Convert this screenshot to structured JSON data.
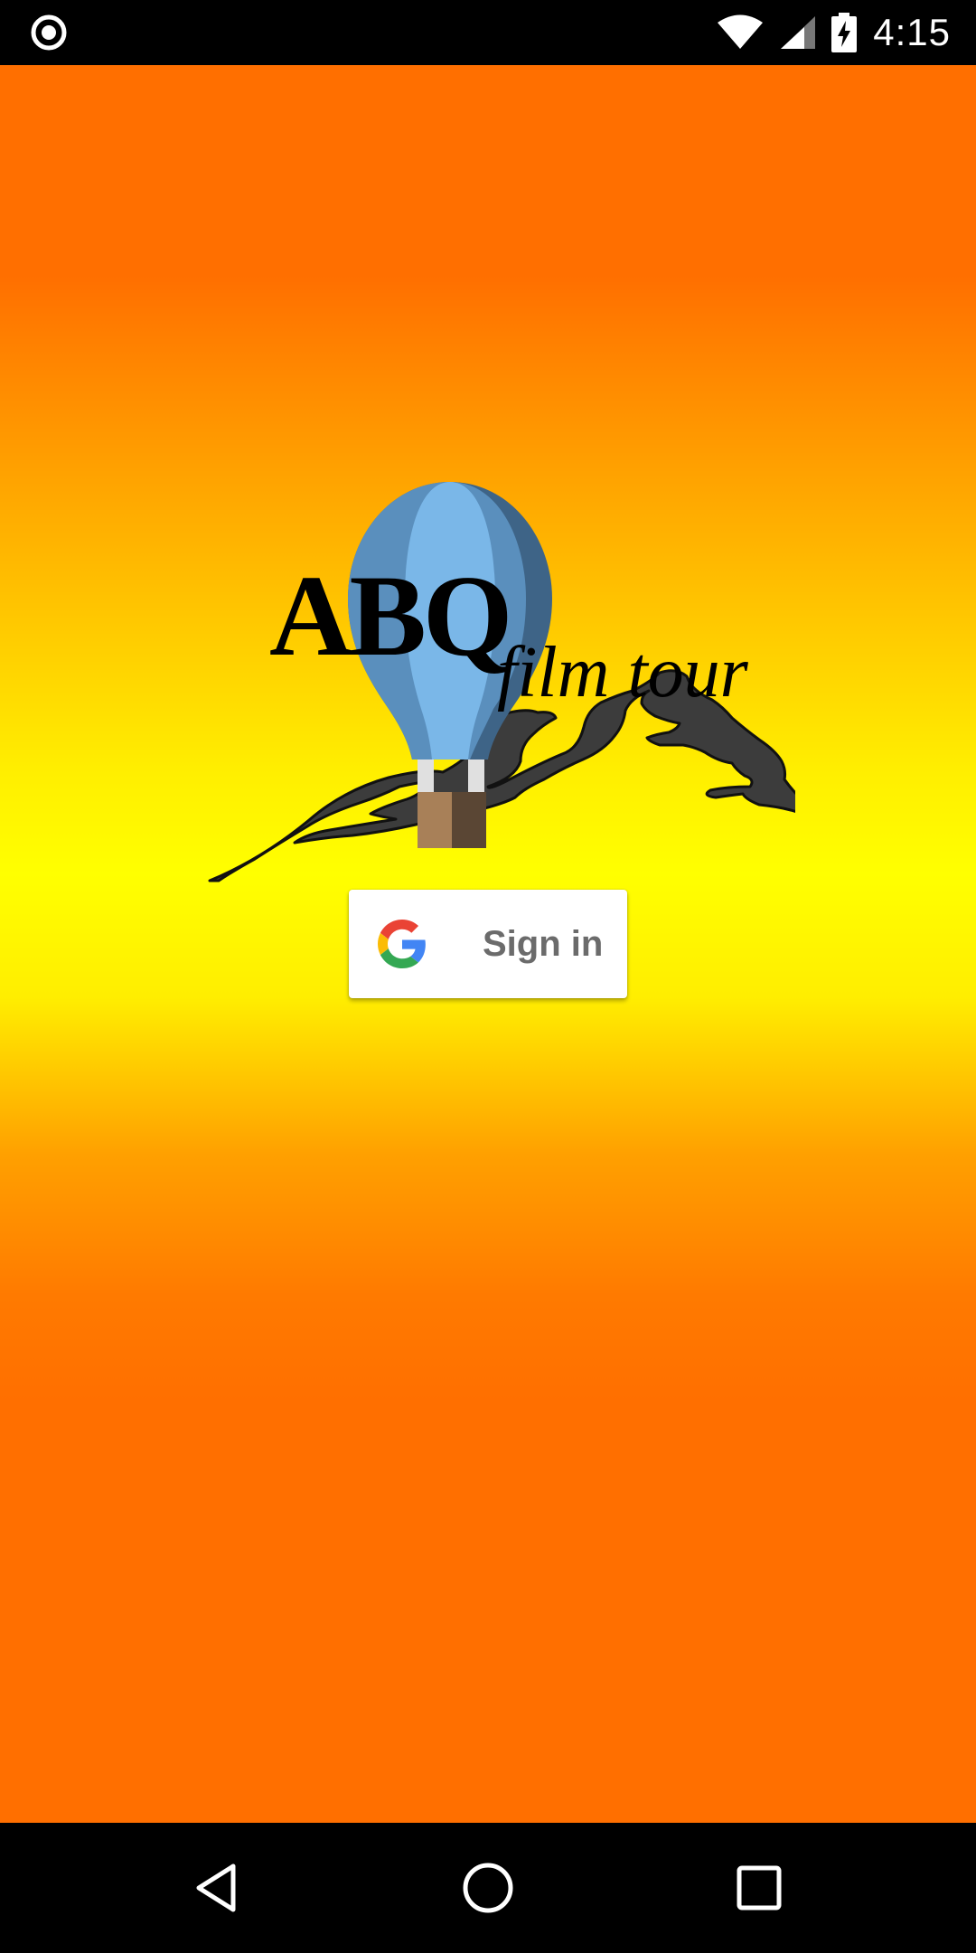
{
  "status_bar": {
    "time": "4:15",
    "icons": [
      "record-indicator-icon",
      "wifi-icon",
      "cell-signal-icon",
      "battery-charging-icon"
    ]
  },
  "logo": {
    "title_main": "ABQ",
    "title_sub": "film tour",
    "icons": [
      "hot-air-balloon-icon",
      "mountains-icon"
    ]
  },
  "signin": {
    "label": "Sign in",
    "icon": "google-g-icon"
  },
  "nav_bar": {
    "icons": [
      "back-icon",
      "home-icon",
      "recents-icon"
    ]
  },
  "colors": {
    "gradient_orange": "#ff6f00",
    "gradient_yellow": "#ffff00",
    "balloon_light": "#7ab7e8",
    "balloon_mid": "#5a8fbd",
    "balloon_dark": "#3e6487",
    "mountain": "#3c3c3c"
  }
}
